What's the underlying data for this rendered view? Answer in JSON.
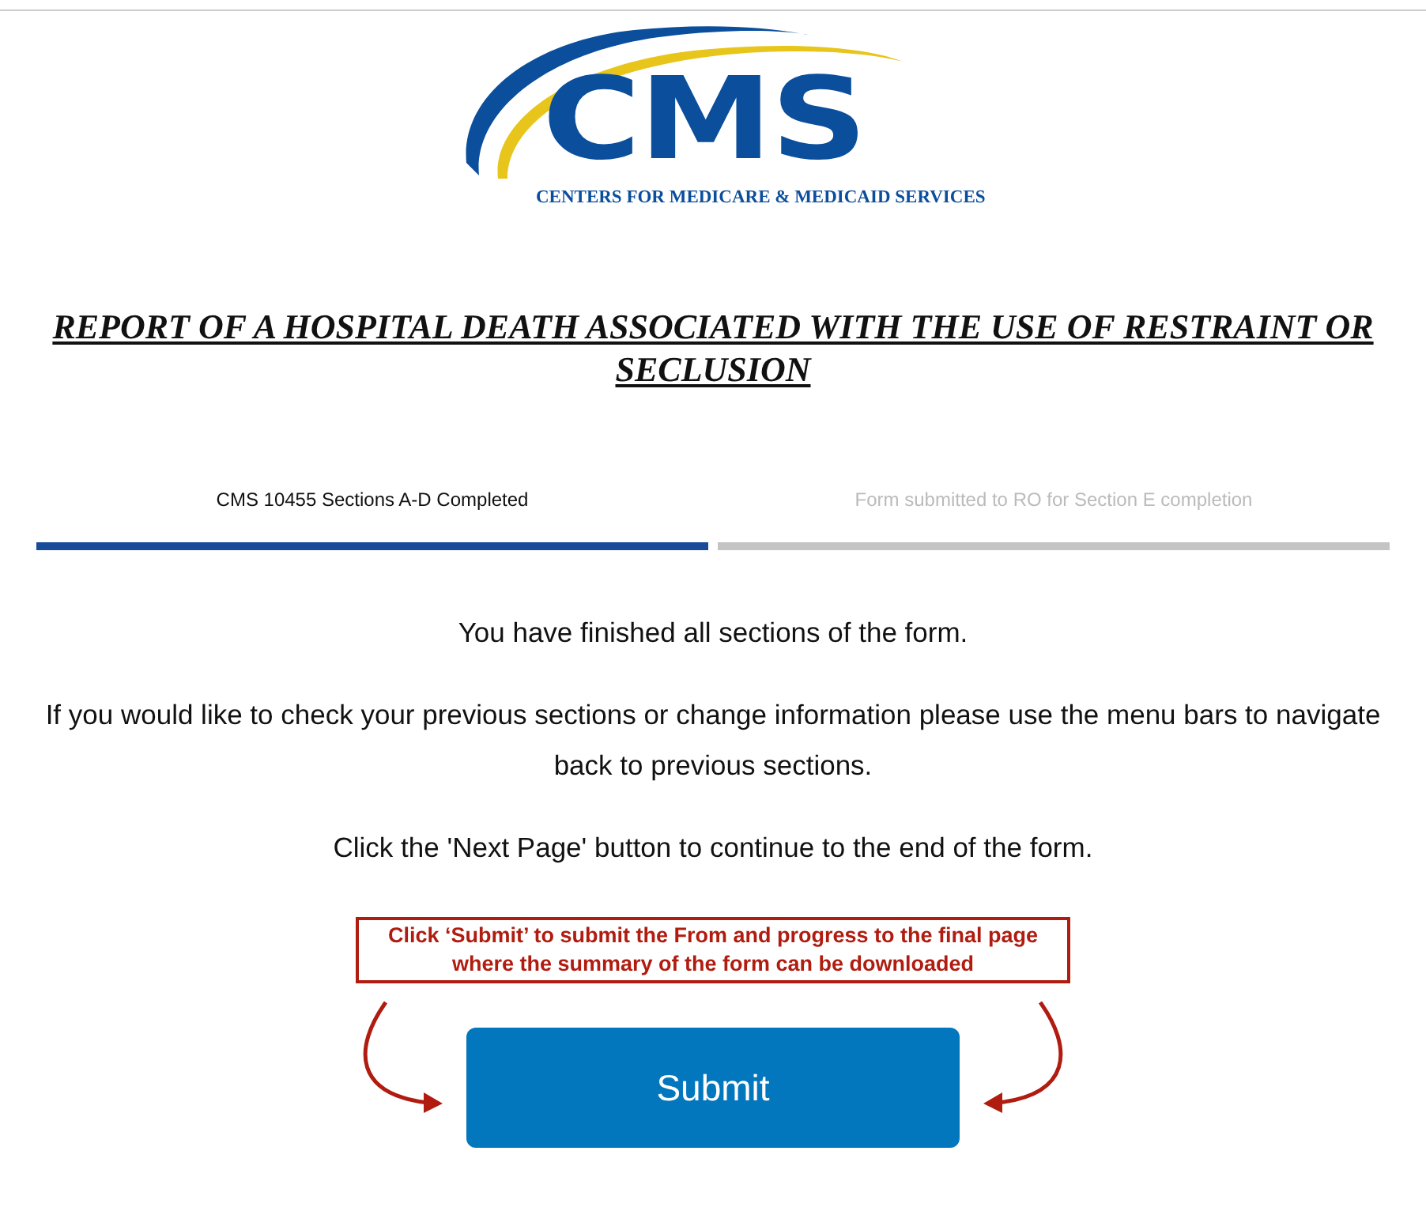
{
  "logo": {
    "mark": "CMS",
    "subtitle": "CENTERS FOR MEDICARE & MEDICAID SERVICES"
  },
  "title": "REPORT OF A HOSPITAL DEATH ASSOCIATED WITH THE USE OF RESTRAINT OR SECLUSION",
  "steps": [
    {
      "label": "CMS 10455 Sections A-D Completed",
      "completed": true
    },
    {
      "label": "Form submitted to RO for Section E completion",
      "completed": false
    }
  ],
  "messages": [
    "You have finished all sections of the form.",
    "If you would like to check your previous sections or change information please use the menu bars to navigate back to previous sections.",
    "Click the 'Next Page' button to continue to the end of the form."
  ],
  "callout": "Click ‘Submit’ to submit the From and progress to the final page where the summary of the form can be downloaded",
  "submit_button": "Submit"
}
